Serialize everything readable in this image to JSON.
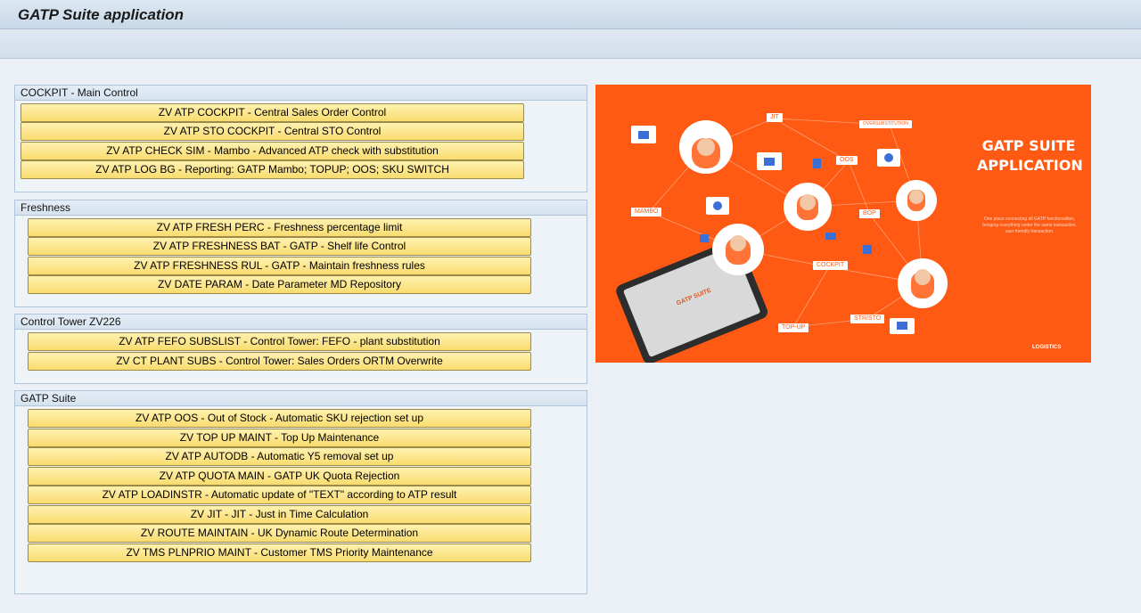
{
  "window": {
    "title": "GATP Suite application"
  },
  "groups": [
    {
      "title": "COCKPIT - Main Control",
      "buttons": [
        "ZV ATP COCKPIT - Central Sales Order Control",
        "ZV ATP STO COCKPIT - Central STO Control",
        "ZV ATP CHECK SIM - Mambo - Advanced ATP check with substitution",
        "ZV ATP LOG BG - Reporting: GATP Mambo; TOPUP; OOS; SKU SWITCH"
      ]
    },
    {
      "title": "Freshness",
      "buttons": [
        "ZV ATP FRESH PERC - Freshness percentage limit",
        "ZV ATP FRESHNESS BAT - GATP - Shelf life Control",
        "ZV ATP FRESHNESS RUL - GATP - Maintain freshness rules",
        "ZV DATE PARAM - Date Parameter MD Repository"
      ]
    },
    {
      "title": "Control Tower ZV226",
      "buttons": [
        "ZV ATP FEFO SUBSLIST - Control Tower: FEFO - plant substitution",
        "ZV CT PLANT SUBS - Control Tower: Sales Orders ORTM Overwrite"
      ]
    },
    {
      "title": "GATP Suite",
      "buttons": [
        "ZV ATP OOS - Out of Stock - Automatic SKU rejection set up",
        "ZV TOP UP MAINT - Top Up Maintenance",
        "ZV ATP AUTODB - Automatic Y5 removal set up",
        "ZV ATP QUOTA MAIN - GATP UK Quota Rejection",
        "ZV ATP LOADINSTR - Automatic update of \"TEXT\" according to ATP result",
        "ZV JIT - JIT - Just in Time Calculation",
        "ZV ROUTE MAINTAIN - UK Dynamic Route Determination",
        "ZV TMS PLNPRIO MAINT - Customer TMS Priority Maintenance"
      ]
    }
  ],
  "banner": {
    "title_line1": "GATP SUITE",
    "title_line2": "APPLICATION",
    "description": "One place connecting all GATP functionalities, bringing everything under the same transaction, user friendly transaction.",
    "tablet_label": "GATP SUITE",
    "brand": "LOGISTICS",
    "nodes": [
      "JIT",
      "OVERSUBSTITUTION",
      "OOS",
      "BOP",
      "MAMBO",
      "COCKPIT",
      "STR/STO",
      "TOP-UP"
    ],
    "accent": "#ff5a14"
  }
}
